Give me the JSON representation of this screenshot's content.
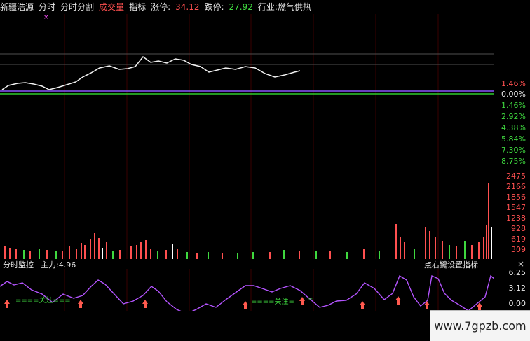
{
  "header": {
    "stock_name": "新疆浩源",
    "tabs": [
      "分时",
      "分时分割"
    ],
    "volume_label": "成交量",
    "indicator_label": "指标",
    "limit_up_label": "涨停:",
    "limit_up_value": "34.12",
    "limit_down_label": "跌停:",
    "limit_down_value": "27.92",
    "industry_label": "行业:燃气供热"
  },
  "main_chart": {
    "ticks_red": [
      "1.46%"
    ],
    "tick_zero": "0.00%",
    "ticks_green": [
      "1.46%",
      "2.92%",
      "4.38%",
      "5.84%",
      "7.30%",
      "8.75%"
    ],
    "close_marker": "×"
  },
  "volume_chart": {
    "ticks": [
      "2475",
      "2166",
      "1856",
      "1547",
      "1238",
      "928",
      "619",
      "309"
    ]
  },
  "sub_chart": {
    "title": "分时监控",
    "main_force_label": "主力:4.96",
    "setting_hint": "点右键设置指标",
    "close": "×",
    "ticks": [
      "6.25",
      "3.12",
      "0.00"
    ],
    "annotation_text": "====关注===",
    "annotation_text_2": "====关注=",
    "annotation_text_3": "="
  },
  "watermark": "www.7gpzb.com",
  "colors": {
    "background": "#000000",
    "red": "#ff5050",
    "green": "#3fd83f",
    "yellow": "#ffd21f",
    "purple": "#b454ff"
  }
}
